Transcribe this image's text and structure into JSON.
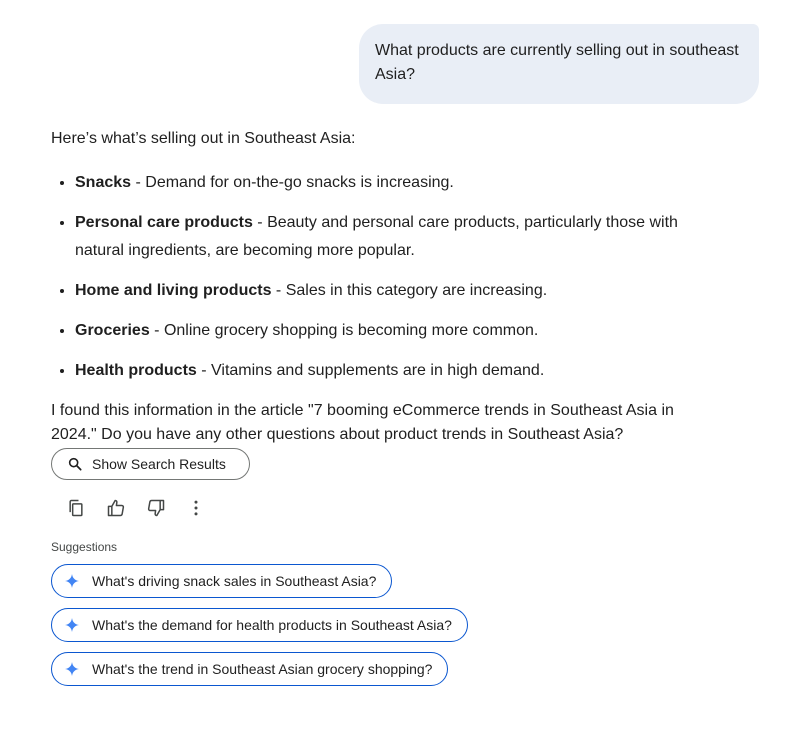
{
  "user_message": "What products are currently selling out in southeast Asia?",
  "response": {
    "intro": "Here’s what’s selling out in Southeast Asia:",
    "items": [
      {
        "title": "Snacks",
        "text": " - Demand for on-the-go snacks is increasing."
      },
      {
        "title": "Personal care products",
        "text": " - Beauty and personal care products, particularly those with natural ingredients, are becoming more popular."
      },
      {
        "title": "Home and living products",
        "text": " - Sales in this category are increasing."
      },
      {
        "title": "Groceries",
        "text": " - Online grocery shopping is becoming more common."
      },
      {
        "title": "Health products",
        "text": " - Vitamins and supplements are in high demand."
      }
    ],
    "closing": "I found this information in the article \"7 booming eCommerce trends in Southeast Asia in 2024.\" Do you have any other questions about product trends in Southeast Asia?"
  },
  "search_button": {
    "label": "Show Search Results",
    "icon": "search-icon"
  },
  "action_icons": [
    "copy-icon",
    "thumbs-up-icon",
    "thumbs-down-icon",
    "more-vert-icon"
  ],
  "suggestions": {
    "label": "Suggestions",
    "items": [
      "What's driving snack sales in Southeast Asia?",
      "What's the demand for health products in Southeast Asia?",
      "What's the trend in Southeast Asian grocery shopping?"
    ]
  },
  "colors": {
    "user_bubble": "#e9eef6",
    "chip_border": "#0b57d0",
    "sparkle": "#4285f4"
  }
}
